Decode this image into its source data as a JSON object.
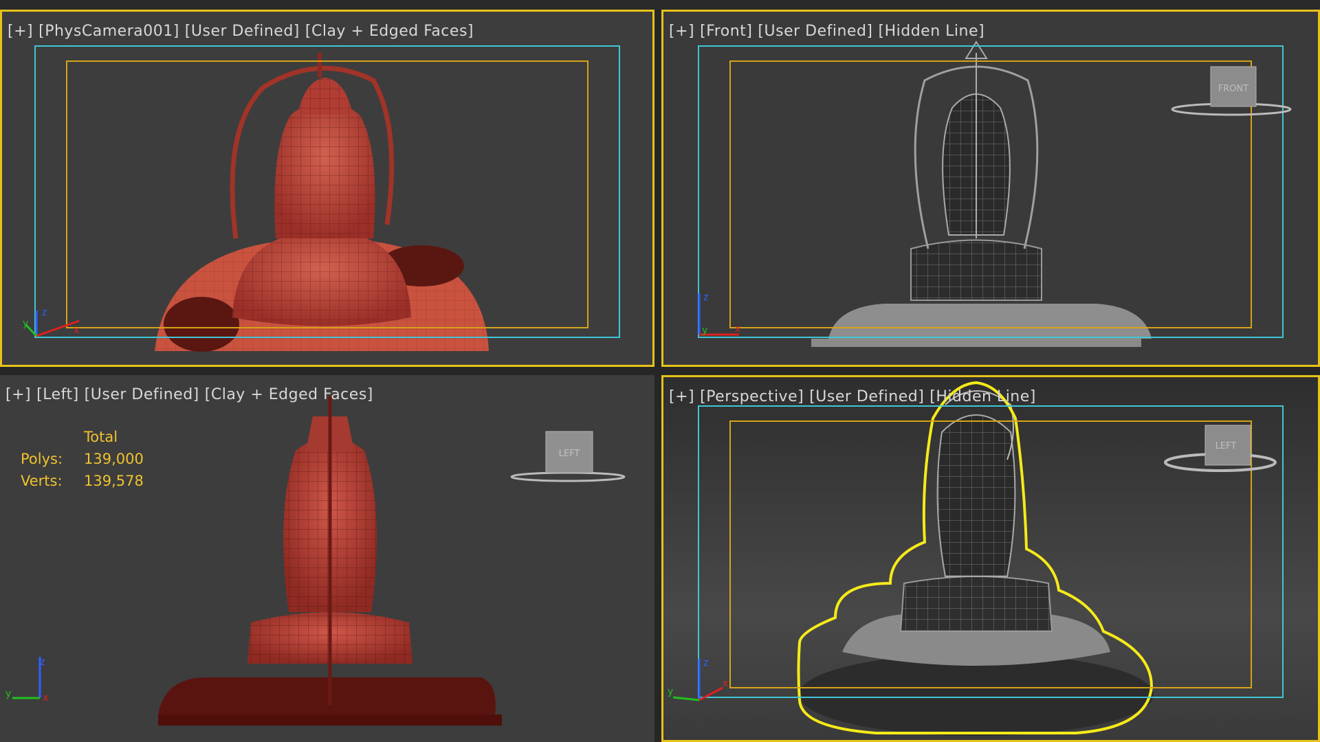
{
  "viewports": {
    "camera": {
      "plus": "[+]",
      "view": "[PhysCamera001]",
      "mode": "[User Defined]",
      "shading": "[Clay + Edged Faces]"
    },
    "front": {
      "plus": "[+]",
      "view": "[Front]",
      "mode": "[User Defined]",
      "shading": "[Hidden Line]",
      "cube_label": "FRONT"
    },
    "left": {
      "plus": "[+]",
      "view": "[Left]",
      "mode": "[User Defined]",
      "shading": "[Clay + Edged Faces]",
      "cube_label": "LEFT"
    },
    "perspective": {
      "plus": "[+]",
      "view": "[Perspective]",
      "mode": "[User Defined]",
      "shading": "[Hidden Line]",
      "cube_label": "LEFT"
    }
  },
  "stats": {
    "total_label": "Total",
    "polys_label": "Polys:",
    "polys_value": "139,000",
    "verts_label": "Verts:",
    "verts_value": "139,578"
  },
  "axis_labels": {
    "x": "x",
    "y": "y",
    "z": "z"
  },
  "colors": {
    "viewport_bg": "#3d3d3d",
    "active_border": "#e8c21a",
    "safe_frame_outer": "#3fc6d6",
    "safe_frame_inner": "#d6a418",
    "clay": "#b8443a",
    "hidden_line": "#9a9a9a",
    "selection": "#f5ea1a",
    "stats_text": "#f0c230"
  },
  "icons": [
    "viewcube-front-icon",
    "viewcube-left-icon",
    "axis-tripod-icon"
  ]
}
